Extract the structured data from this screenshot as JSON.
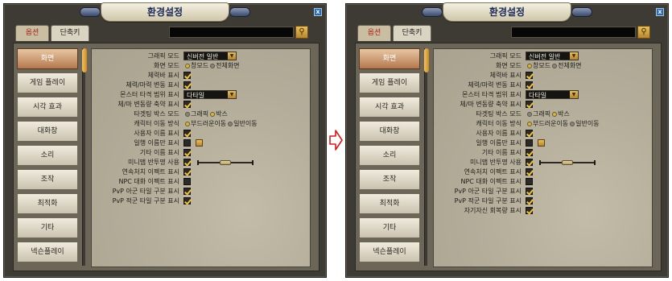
{
  "left": {
    "title": "환경설정",
    "close_label": "x",
    "tabs": [
      {
        "label": "옵션"
      },
      {
        "label": "단축키"
      }
    ],
    "search": {
      "value": "",
      "icon": "search-icon"
    },
    "sidebar": [
      {
        "label": "화면",
        "active": true
      },
      {
        "label": "게임 플레이"
      },
      {
        "label": "시각 효과"
      },
      {
        "label": "대화창"
      },
      {
        "label": "소리"
      },
      {
        "label": "조작"
      },
      {
        "label": "최적화"
      },
      {
        "label": "기타"
      },
      {
        "label": "넥슨플레이"
      }
    ],
    "rows": [
      {
        "label": "그래픽 모드",
        "dropdown": "신버전 일반"
      },
      {
        "label": "화면 모드",
        "radios": [
          {
            "label": "창모드",
            "on": true
          },
          {
            "label": "전체화면",
            "on": false
          }
        ]
      },
      {
        "label": "체력바 표시",
        "check": true
      },
      {
        "label": "체력/마력 변동 표시",
        "check": true
      },
      {
        "label": "몬스터 타격 범위 표시",
        "dropdown": "다타일"
      },
      {
        "label": "체/마 변동량 축약 표시",
        "check": true
      },
      {
        "label": "타겟팅 박스 모드",
        "radios": [
          {
            "label": "그래픽",
            "on": false
          },
          {
            "label": "박스",
            "on": true
          }
        ]
      },
      {
        "label": "캐릭터 이동 방식",
        "radios": [
          {
            "label": "부드러운이동",
            "on": true
          },
          {
            "label": "일반이동",
            "on": false
          }
        ]
      },
      {
        "label": "사용자 이름 표시",
        "check": true
      },
      {
        "label": "일행 이름만 표시",
        "check": false,
        "swatch": true
      },
      {
        "label": "기타 이름 표시",
        "check": true
      },
      {
        "label": "미니맵 반투명 사용",
        "check": true,
        "slider": 0.5
      },
      {
        "label": "연속처치 이펙트 표시",
        "check": true
      },
      {
        "label": "NPC 대화 이펙트 표시",
        "check": false
      },
      {
        "label": "PvP 아군 타일 구분 표시",
        "check": true
      },
      {
        "label": "PvP 적군 타일 구분 표시",
        "check": true
      }
    ]
  },
  "right": {
    "title": "환경설정",
    "close_label": "x",
    "tabs": [
      {
        "label": "옵션"
      },
      {
        "label": "단축키"
      }
    ],
    "search": {
      "value": "",
      "icon": "search-icon"
    },
    "sidebar": [
      {
        "label": "화면",
        "active": true
      },
      {
        "label": "게임 플레이"
      },
      {
        "label": "시각 효과"
      },
      {
        "label": "대화창"
      },
      {
        "label": "소리"
      },
      {
        "label": "조작"
      },
      {
        "label": "최적화"
      },
      {
        "label": "기타"
      },
      {
        "label": "넥슨플레이"
      }
    ],
    "rows": [
      {
        "label": "그래픽 모드",
        "dropdown": "신버전 일반"
      },
      {
        "label": "화면 모드",
        "radios": [
          {
            "label": "창모드",
            "on": true
          },
          {
            "label": "전체화면",
            "on": false
          }
        ]
      },
      {
        "label": "체력바 표시",
        "check": true
      },
      {
        "label": "체력/마력 변동 표시",
        "check": true
      },
      {
        "label": "몬스터 타격 범위 표시",
        "dropdown": "다타일"
      },
      {
        "label": "체/마 변동량 축약 표시",
        "check": true
      },
      {
        "label": "타겟팅 박스 모드",
        "radios": [
          {
            "label": "그래픽",
            "on": false
          },
          {
            "label": "박스",
            "on": true
          }
        ]
      },
      {
        "label": "캐릭터 이동 방식",
        "radios": [
          {
            "label": "부드러운이동",
            "on": true
          },
          {
            "label": "일반이동",
            "on": false
          }
        ]
      },
      {
        "label": "사용자 이름 표시",
        "check": true
      },
      {
        "label": "일행 이름만 표시",
        "check": false,
        "swatch": true
      },
      {
        "label": "기타 이름 표시",
        "check": true
      },
      {
        "label": "미니맵 반투명 사용",
        "check": true,
        "slider": 0.5
      },
      {
        "label": "연속처치 이펙트 표시",
        "check": true
      },
      {
        "label": "NPC 대화 이펙트 표시",
        "check": false
      },
      {
        "label": "PvP 아군 타일 구분 표시",
        "check": true
      },
      {
        "label": "PvP 적군 타일 구분 표시",
        "check": true
      },
      {
        "label": "자기자신 회복량 표시",
        "check": true
      }
    ]
  },
  "colors": {
    "arrow_stroke": "#d61a1a",
    "accent_gold": "#e3b54a",
    "tab_active_text": "#a9201a",
    "title_text": "#1b2a5a"
  }
}
